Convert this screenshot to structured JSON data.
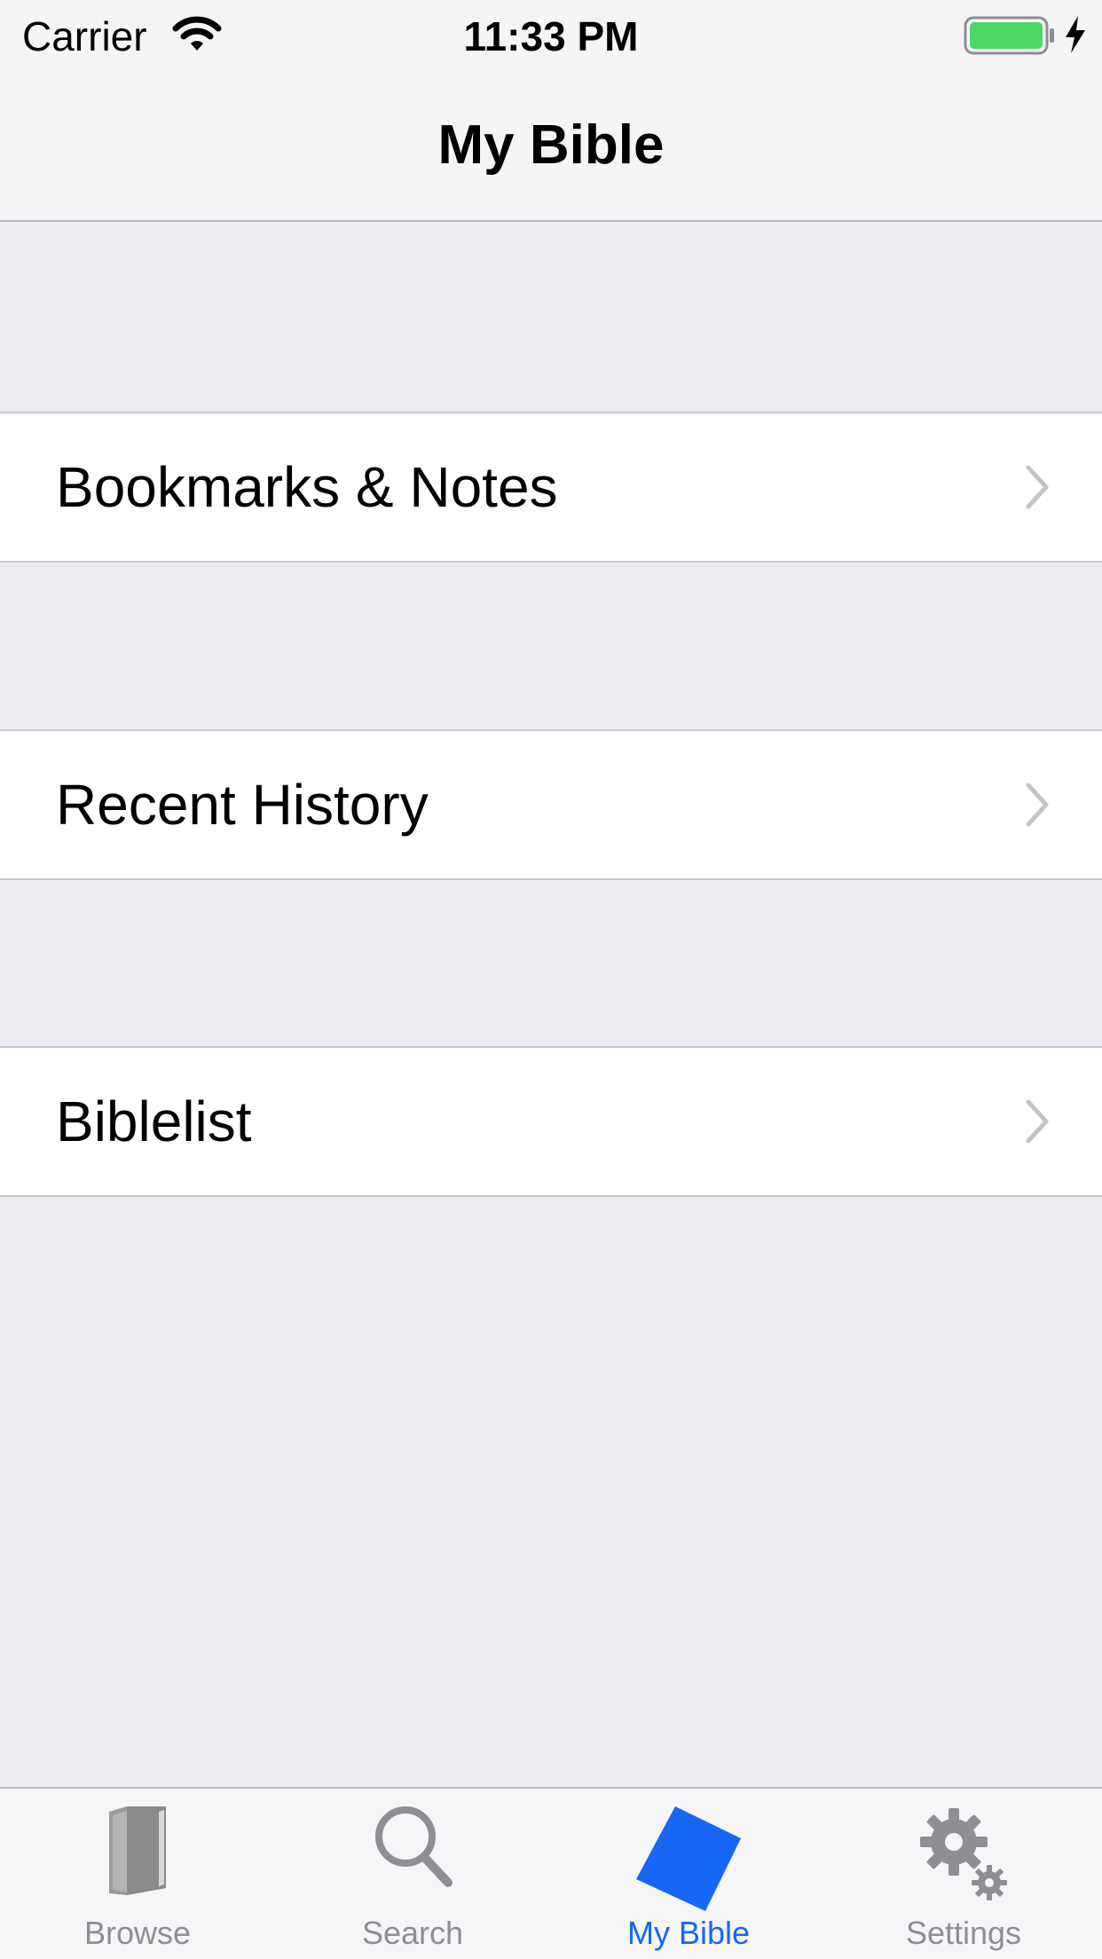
{
  "status_bar": {
    "carrier": "Carrier",
    "time": "11:33 PM"
  },
  "nav": {
    "title": "My Bible"
  },
  "rows": [
    {
      "label": "Bookmarks & Notes"
    },
    {
      "label": "Recent History"
    },
    {
      "label": "Biblelist"
    }
  ],
  "tabs": [
    {
      "label": "Browse",
      "icon": "book-icon",
      "active": false
    },
    {
      "label": "Search",
      "icon": "search-icon",
      "active": false
    },
    {
      "label": "My Bible",
      "icon": "bible-icon",
      "active": true
    },
    {
      "label": "Settings",
      "icon": "gear-icon",
      "active": false
    }
  ],
  "colors": {
    "accent": "#1667f5",
    "inactive": "#8e8e93",
    "battery": "#4cd964",
    "background": "#ebebf1"
  }
}
